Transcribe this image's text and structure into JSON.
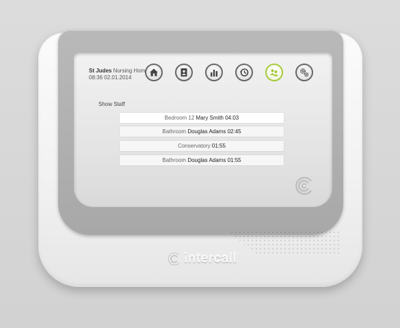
{
  "status": {
    "home_name": "St Judes",
    "home_suffix": "Nursing Home",
    "time": "08:36",
    "date": "02.01.2014"
  },
  "nav": [
    {
      "icon": "home-icon",
      "active": false
    },
    {
      "icon": "contacts-book-icon",
      "active": false
    },
    {
      "icon": "bar-chart-icon",
      "active": false
    },
    {
      "icon": "history-clock-icon",
      "active": false
    },
    {
      "icon": "staff-group-icon",
      "active": true
    },
    {
      "icon": "settings-gears-icon",
      "active": false
    }
  ],
  "staff_heading": "Show Staff",
  "staff_rows": [
    {
      "location": "Bedroom 12",
      "name": "Mary Smith",
      "time": "04:03"
    },
    {
      "location": "Bathroom",
      "name": "Douglas Adams",
      "time": "02:45"
    },
    {
      "location": "Conservatory",
      "name": "",
      "time": "01:55"
    },
    {
      "location": "Bathroom",
      "name": "Douglas Adams",
      "time": "01:55"
    }
  ],
  "brand": "intercall",
  "colors": {
    "active_accent": "#a6c93a",
    "bezel": "#b0b0b0"
  }
}
